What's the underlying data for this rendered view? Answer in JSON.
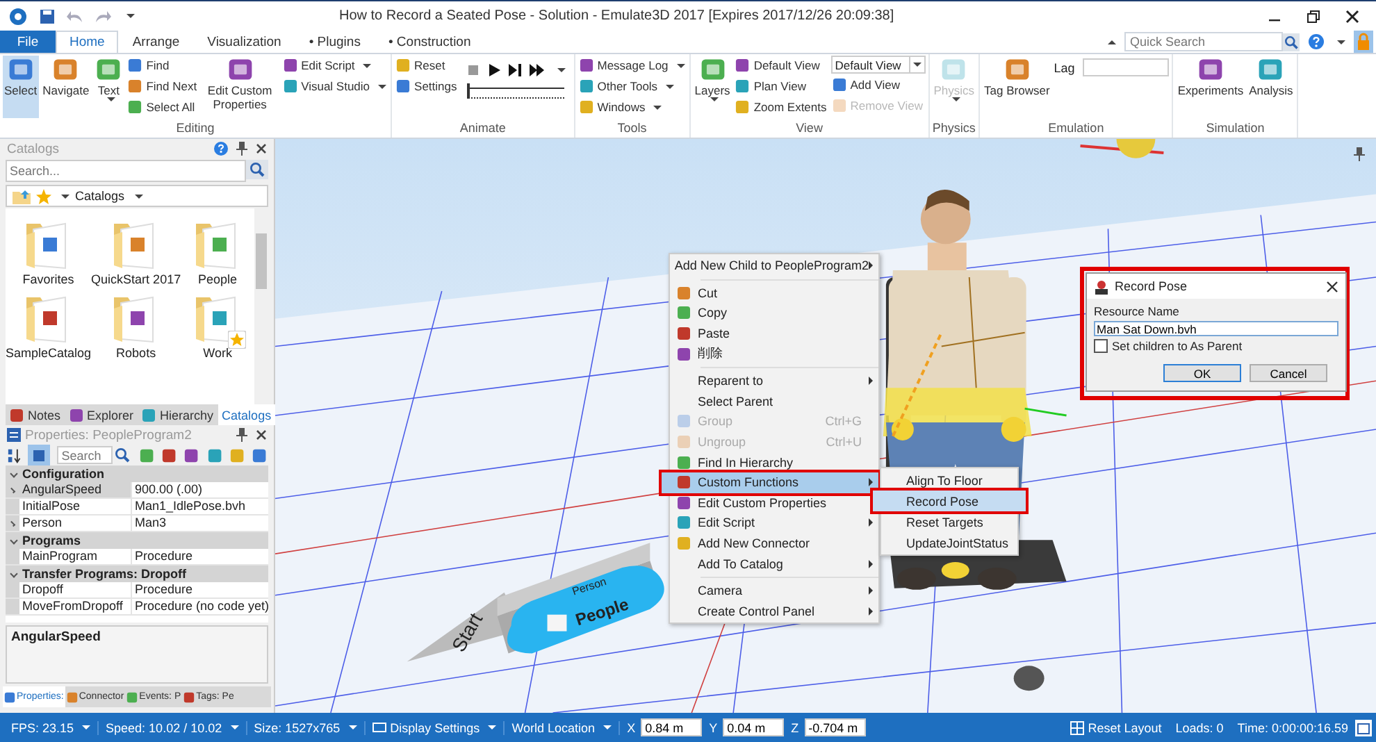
{
  "title_bar": {
    "title": "How to Record a Seated Pose - Solution - Emulate3D 2017 [Expires 2017/12/26 20:09:38]"
  },
  "ribbon_tabs": [
    {
      "label": "File",
      "kind": "file",
      "selected": false
    },
    {
      "label": "Home",
      "kind": "tab",
      "selected": true
    },
    {
      "label": "Arrange",
      "kind": "tab",
      "selected": false
    },
    {
      "label": "Visualization",
      "kind": "tab",
      "selected": false
    },
    {
      "label": "• Plugins",
      "kind": "tab",
      "selected": false
    },
    {
      "label": "• Construction",
      "kind": "tab",
      "selected": false
    }
  ],
  "quick_search": {
    "placeholder": "Quick Search"
  },
  "ribbon_groups": [
    {
      "label": "Editing",
      "columns": [
        [
          {
            "kind": "large",
            "label": "Select",
            "selected": true,
            "disabled": false,
            "dropdown": false
          }
        ],
        [
          {
            "kind": "large",
            "label": "Navigate",
            "selected": false,
            "disabled": false,
            "dropdown": false
          }
        ],
        [
          {
            "kind": "large",
            "label": "Text",
            "selected": false,
            "disabled": false,
            "dropdown": true
          }
        ],
        [
          {
            "kind": "small",
            "label": "Find",
            "selected": false,
            "disabled": false,
            "dropdown": false
          },
          {
            "kind": "small",
            "label": "Find Next",
            "selected": false,
            "disabled": false,
            "dropdown": false
          },
          {
            "kind": "small",
            "label": "Select All",
            "selected": false,
            "disabled": false,
            "dropdown": false
          }
        ],
        [
          {
            "kind": "large",
            "label": "Edit Custom Properties",
            "selected": false,
            "disabled": false,
            "dropdown": false
          }
        ],
        [
          {
            "kind": "small",
            "label": "Edit Script",
            "selected": false,
            "disabled": false,
            "dropdown": true
          },
          {
            "kind": "small",
            "label": "Visual Studio",
            "selected": false,
            "disabled": false,
            "dropdown": true
          }
        ]
      ]
    },
    {
      "label": "Animate",
      "columns": [
        [
          {
            "kind": "small",
            "label": "Reset",
            "selected": false,
            "disabled": false,
            "dropdown": false
          },
          {
            "kind": "small",
            "label": "Settings",
            "selected": false,
            "disabled": false,
            "dropdown": false
          }
        ],
        [
          {
            "kind": "player",
            "level": 0
          }
        ]
      ]
    },
    {
      "label": "Tools",
      "columns": [
        [
          {
            "kind": "small",
            "label": "Message Log",
            "selected": false,
            "disabled": false,
            "dropdown": true
          },
          {
            "kind": "small",
            "label": "Other Tools",
            "selected": false,
            "disabled": false,
            "dropdown": true
          },
          {
            "kind": "small",
            "label": "Windows",
            "selected": false,
            "disabled": false,
            "dropdown": true
          }
        ]
      ]
    },
    {
      "label": "View",
      "columns": [
        [
          {
            "kind": "large",
            "label": "Layers",
            "selected": false,
            "disabled": false,
            "dropdown": true
          }
        ],
        [
          {
            "kind": "small",
            "label": "Default View",
            "selected": false,
            "disabled": false,
            "dropdown": false
          },
          {
            "kind": "small",
            "label": "Plan View",
            "selected": false,
            "disabled": false,
            "dropdown": false
          },
          {
            "kind": "small",
            "label": "Zoom Extents",
            "selected": false,
            "disabled": false,
            "dropdown": false
          }
        ],
        [
          {
            "kind": "combo",
            "value": "Default View"
          },
          {
            "kind": "small",
            "label": "Add View",
            "selected": false,
            "disabled": false,
            "dropdown": false
          },
          {
            "kind": "small",
            "label": "Remove View",
            "selected": false,
            "disabled": true,
            "dropdown": false
          }
        ]
      ]
    },
    {
      "label": "Physics",
      "columns": [
        [
          {
            "kind": "large",
            "label": "Physics",
            "selected": false,
            "disabled": true,
            "dropdown": true
          }
        ]
      ]
    },
    {
      "label": "Emulation",
      "columns": [
        [
          {
            "kind": "large",
            "label": "Tag Browser",
            "selected": false,
            "disabled": false,
            "dropdown": false
          }
        ],
        [
          {
            "kind": "field",
            "label": "Lag"
          }
        ]
      ]
    },
    {
      "label": "Simulation",
      "columns": [
        [
          {
            "kind": "large",
            "label": "Experiments",
            "selected": false,
            "disabled": false,
            "dropdown": false
          }
        ],
        [
          {
            "kind": "large",
            "label": "Analysis",
            "selected": false,
            "disabled": false,
            "dropdown": false
          }
        ]
      ]
    }
  ],
  "catalogs": {
    "title": "Catalogs",
    "search_placeholder": "Search...",
    "breadcrumb": "Catalogs",
    "folders": [
      {
        "label": "Favorites",
        "starred": false
      },
      {
        "label": "QuickStart 2017",
        "starred": false
      },
      {
        "label": "People",
        "starred": false
      },
      {
        "label": "SampleCatalog",
        "starred": false
      },
      {
        "label": "Robots",
        "starred": false
      },
      {
        "label": "Work",
        "starred": true
      }
    ],
    "tabs": [
      {
        "label": "Notes",
        "selected": false
      },
      {
        "label": "Explorer",
        "selected": false
      },
      {
        "label": "Hierarchy",
        "selected": false
      },
      {
        "label": "Catalogs",
        "selected": true
      }
    ]
  },
  "properties": {
    "title": "Properties: PeopleProgram2",
    "search_placeholder": "Search",
    "categories": [
      {
        "label": "Configuration",
        "expanded": true,
        "rows": [
          {
            "name": "AngularSpeed",
            "value": "900.00 (.00)",
            "expandable": true,
            "selected": true
          },
          {
            "name": "InitialPose",
            "value": "Man1_IdlePose.bvh",
            "expandable": false,
            "selected": false
          },
          {
            "name": "Person",
            "value": "Man3",
            "expandable": true,
            "selected": false
          }
        ]
      },
      {
        "label": "Programs",
        "expanded": true,
        "rows": [
          {
            "name": "MainProgram",
            "value": "Procedure",
            "expandable": false,
            "selected": false
          }
        ]
      },
      {
        "label": "Transfer Programs: Dropoff",
        "expanded": true,
        "rows": [
          {
            "name": "Dropoff",
            "value": "Procedure",
            "expandable": false,
            "selected": false
          },
          {
            "name": "MoveFromDropoff",
            "value": "Procedure (no code yet)",
            "expandable": false,
            "selected": false
          }
        ]
      }
    ],
    "description": "AngularSpeed",
    "tabs": [
      {
        "label": "Properties:",
        "selected": true
      },
      {
        "label": "Connector",
        "selected": false
      },
      {
        "label": "Events: P",
        "selected": false
      },
      {
        "label": "Tags: Pe",
        "selected": false
      }
    ]
  },
  "scene_labels": [
    "Start",
    "Person",
    "People"
  ],
  "context_menu": {
    "sections": [
      [
        {
          "label": "Add New Child to PeopleProgram2",
          "submenu": true,
          "disabled": false,
          "selected": false,
          "annotated": false,
          "icon": false
        }
      ],
      [
        {
          "label": "Cut",
          "submenu": false,
          "disabled": false,
          "selected": false,
          "annotated": false,
          "icon": true
        },
        {
          "label": "Copy",
          "submenu": false,
          "disabled": false,
          "selected": false,
          "annotated": false,
          "icon": true
        },
        {
          "label": "Paste",
          "submenu": false,
          "disabled": false,
          "selected": false,
          "annotated": false,
          "icon": true
        },
        {
          "label": "削除",
          "submenu": false,
          "disabled": false,
          "selected": false,
          "annotated": false,
          "icon": true
        }
      ],
      [
        {
          "label": "Reparent to",
          "submenu": true,
          "disabled": false,
          "selected": false,
          "annotated": false,
          "icon": false
        },
        {
          "label": "Select Parent",
          "submenu": false,
          "disabled": false,
          "selected": false,
          "annotated": false,
          "icon": false
        },
        {
          "label": "Group",
          "shortcut": "Ctrl+G",
          "submenu": false,
          "disabled": true,
          "selected": false,
          "annotated": false,
          "icon": true
        },
        {
          "label": "Ungroup",
          "shortcut": "Ctrl+U",
          "submenu": false,
          "disabled": true,
          "selected": false,
          "annotated": false,
          "icon": true
        },
        {
          "label": "Find In Hierarchy",
          "submenu": false,
          "disabled": false,
          "selected": false,
          "annotated": false,
          "icon": true
        },
        {
          "label": "Custom Functions",
          "submenu": true,
          "disabled": false,
          "selected": true,
          "annotated": true,
          "icon": true
        },
        {
          "label": "Edit Custom Properties",
          "submenu": false,
          "disabled": false,
          "selected": false,
          "annotated": false,
          "icon": true
        },
        {
          "label": "Edit Script",
          "submenu": true,
          "disabled": false,
          "selected": false,
          "annotated": false,
          "icon": true
        },
        {
          "label": "Add New Connector",
          "submenu": false,
          "disabled": false,
          "selected": false,
          "annotated": false,
          "icon": true
        },
        {
          "label": "Add To Catalog",
          "submenu": true,
          "disabled": false,
          "selected": false,
          "annotated": false,
          "icon": false
        }
      ],
      [
        {
          "label": "Camera",
          "submenu": true,
          "disabled": false,
          "selected": false,
          "annotated": false,
          "icon": false
        },
        {
          "label": "Create Control Panel",
          "submenu": true,
          "disabled": false,
          "selected": false,
          "annotated": false,
          "icon": false
        }
      ]
    ]
  },
  "submenu": [
    {
      "label": "Align To Floor",
      "selected": false,
      "annotated": false
    },
    {
      "label": "Record Pose",
      "selected": true,
      "annotated": true
    },
    {
      "label": "Reset Targets",
      "selected": false,
      "annotated": false
    },
    {
      "label": "UpdateJointStatus",
      "selected": false,
      "annotated": false
    }
  ],
  "dialog": {
    "title": "Record Pose",
    "annotated": true,
    "field_label": "Resource Name",
    "field_value": "Man Sat Down.bvh",
    "checkbox": {
      "label": "Set children to As Parent",
      "checked": false
    },
    "buttons": [
      {
        "label": "OK",
        "selected": true
      },
      {
        "label": "Cancel",
        "selected": false
      }
    ]
  },
  "status_bar": {
    "left": [
      {
        "kind": "dropdown",
        "label": "FPS: 23.15"
      },
      {
        "kind": "dropdown",
        "label": "Speed: 10.02 / 10.02"
      },
      {
        "kind": "dropdown",
        "label": "Size: 1527x765"
      },
      {
        "kind": "display",
        "label": "Display Settings"
      },
      {
        "kind": "dropdown",
        "label": "World Location"
      },
      {
        "kind": "coord",
        "label": "X",
        "value": "0.84 m"
      },
      {
        "kind": "coord",
        "label": "Y",
        "value": "0.04 m"
      },
      {
        "kind": "coord",
        "label": "Z",
        "value": "-0.704 m"
      }
    ],
    "right": [
      {
        "kind": "layout",
        "label": "Reset Layout"
      },
      {
        "kind": "text",
        "label": "Loads: 0"
      },
      {
        "kind": "text",
        "label": "Time: 0:00:00:16.59"
      }
    ]
  }
}
